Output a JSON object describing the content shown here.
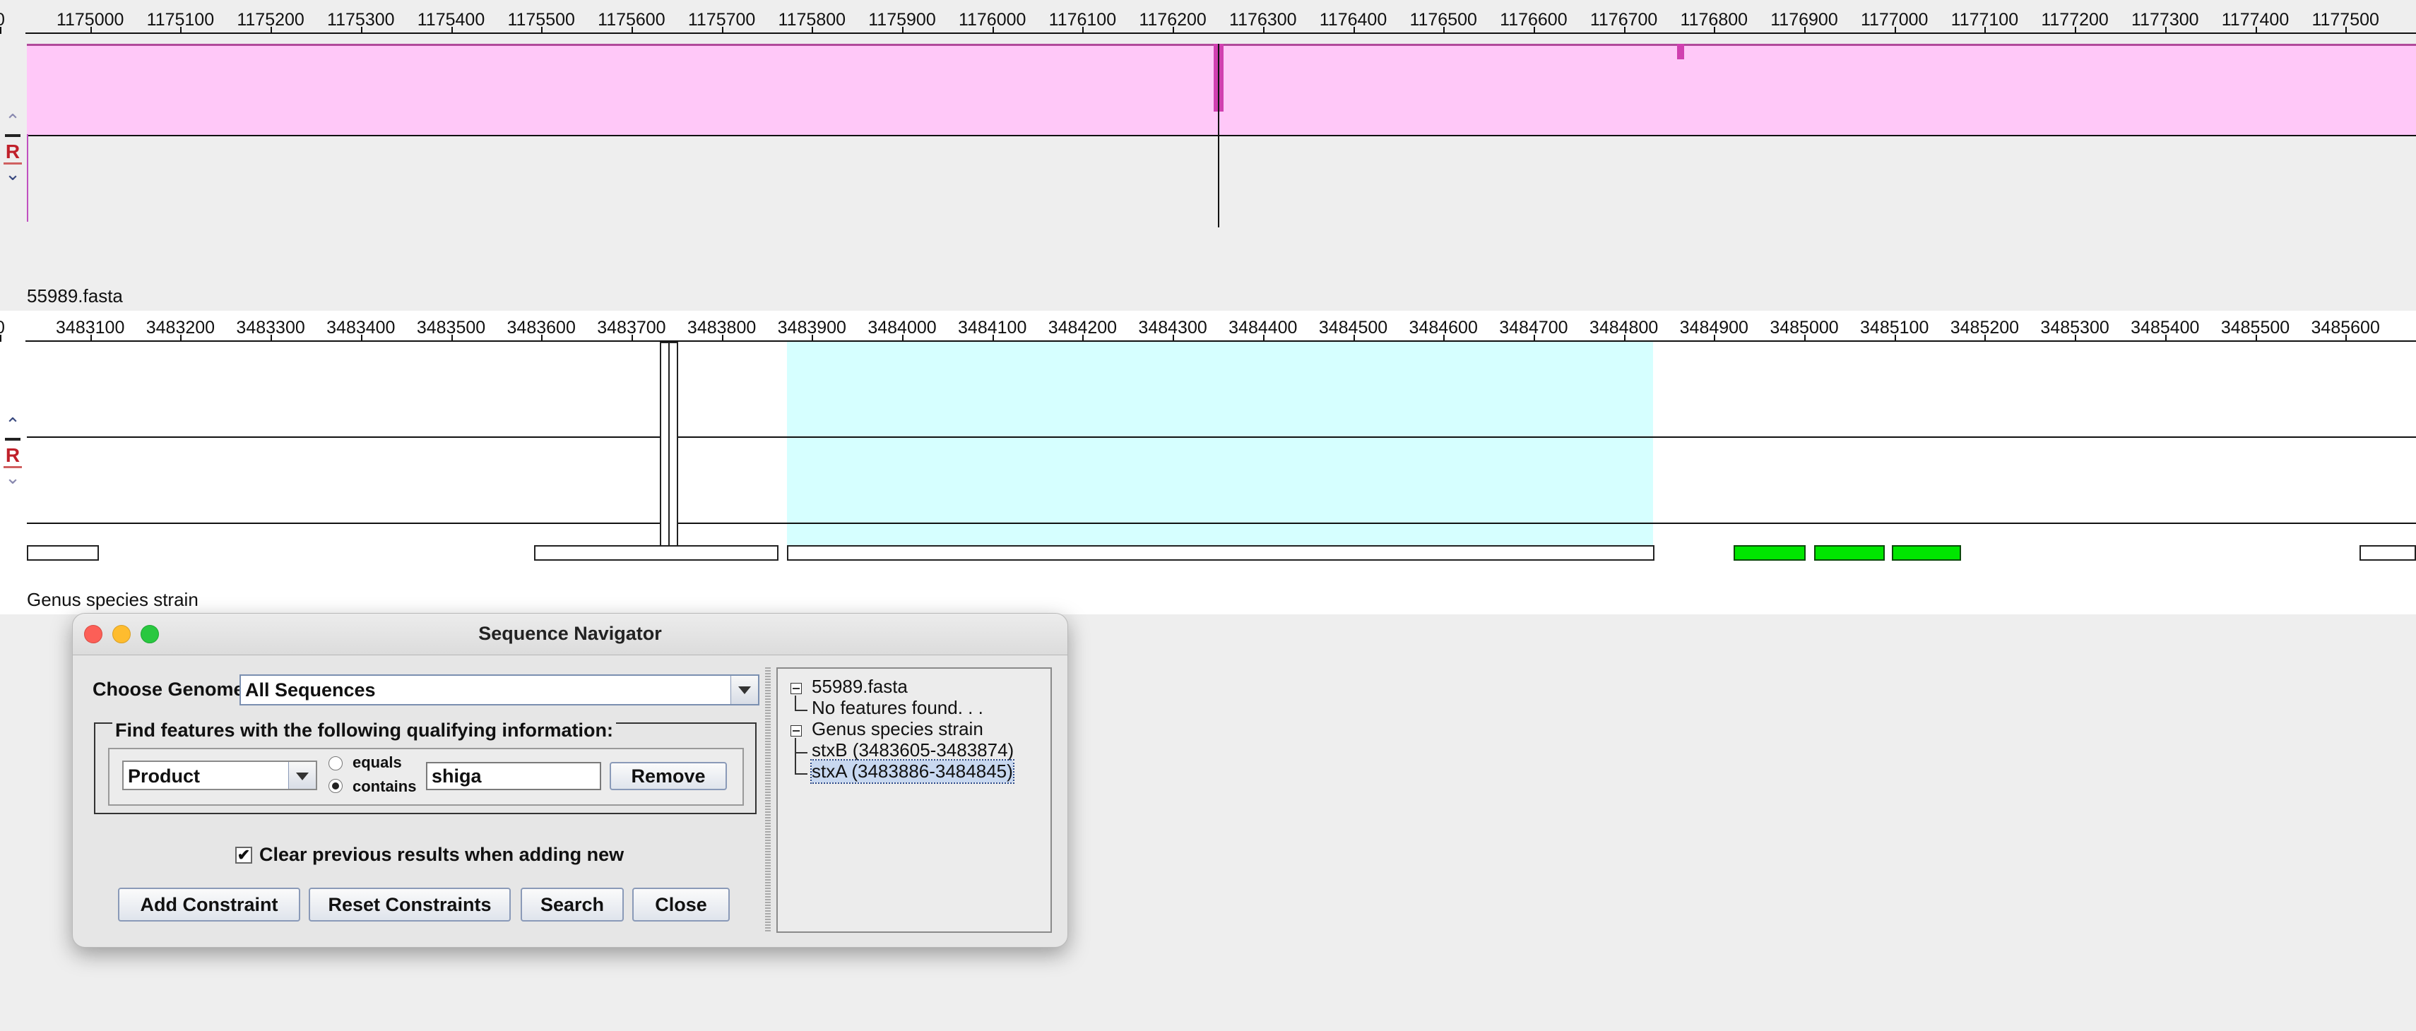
{
  "track1": {
    "ruler_labels": [
      "0",
      "1175000",
      "1175100",
      "1175200",
      "1175300",
      "1175400",
      "1175500",
      "1175600",
      "1175700",
      "1175800",
      "1175900",
      "1176000",
      "1176100",
      "1176200",
      "1176300",
      "1176400",
      "1176500",
      "1176600",
      "1176700",
      "1176800",
      "1176900",
      "1177000",
      "1177100",
      "1177200",
      "1177300",
      "1177400",
      "1177500"
    ],
    "colors": {
      "band": "#ffc8f8",
      "band_edge": "#b04a9a"
    },
    "side_controls": {
      "strand_label": "R"
    }
  },
  "track2": {
    "title": "55989.fasta",
    "ruler_labels": [
      "0",
      "3483100",
      "3483200",
      "3483300",
      "3483400",
      "3483500",
      "3483600",
      "3483700",
      "3483800",
      "3483900",
      "3484000",
      "3484100",
      "3484200",
      "3484300",
      "3484400",
      "3484500",
      "3484600",
      "3484700",
      "3484800",
      "3484900",
      "3485000",
      "3485100",
      "3485200",
      "3485300",
      "3485400",
      "3485500",
      "3485600"
    ],
    "colors": {
      "highlight": "#d6ffff",
      "gene": "#00e600"
    },
    "side_controls": {
      "strand_label": "R"
    }
  },
  "track3": {
    "title": "Genus species strain"
  },
  "dialog": {
    "title": "Sequence Navigator",
    "choose_genome_label": "Choose Genome:",
    "genome_selected": "All Sequences",
    "group_label": "Find features with the following qualifying information:",
    "field_selected": "Product",
    "radio_equals": "equals",
    "radio_contains": "contains",
    "radio_selected": "contains",
    "search_value": "shiga",
    "remove_label": "Remove",
    "clear_checkbox_label": "Clear previous results when adding new",
    "clear_checked": true,
    "buttons": {
      "add_constraint": "Add Constraint",
      "reset_constraints": "Reset Constraints",
      "search": "Search",
      "close": "Close"
    },
    "tree": {
      "node1": "55989.fasta",
      "node1_child": "No features found. . .",
      "node2": "Genus species strain",
      "node2_child1": "stxB (3483605-3483874)",
      "node2_child2": "stxA (3483886-3484845)"
    }
  }
}
